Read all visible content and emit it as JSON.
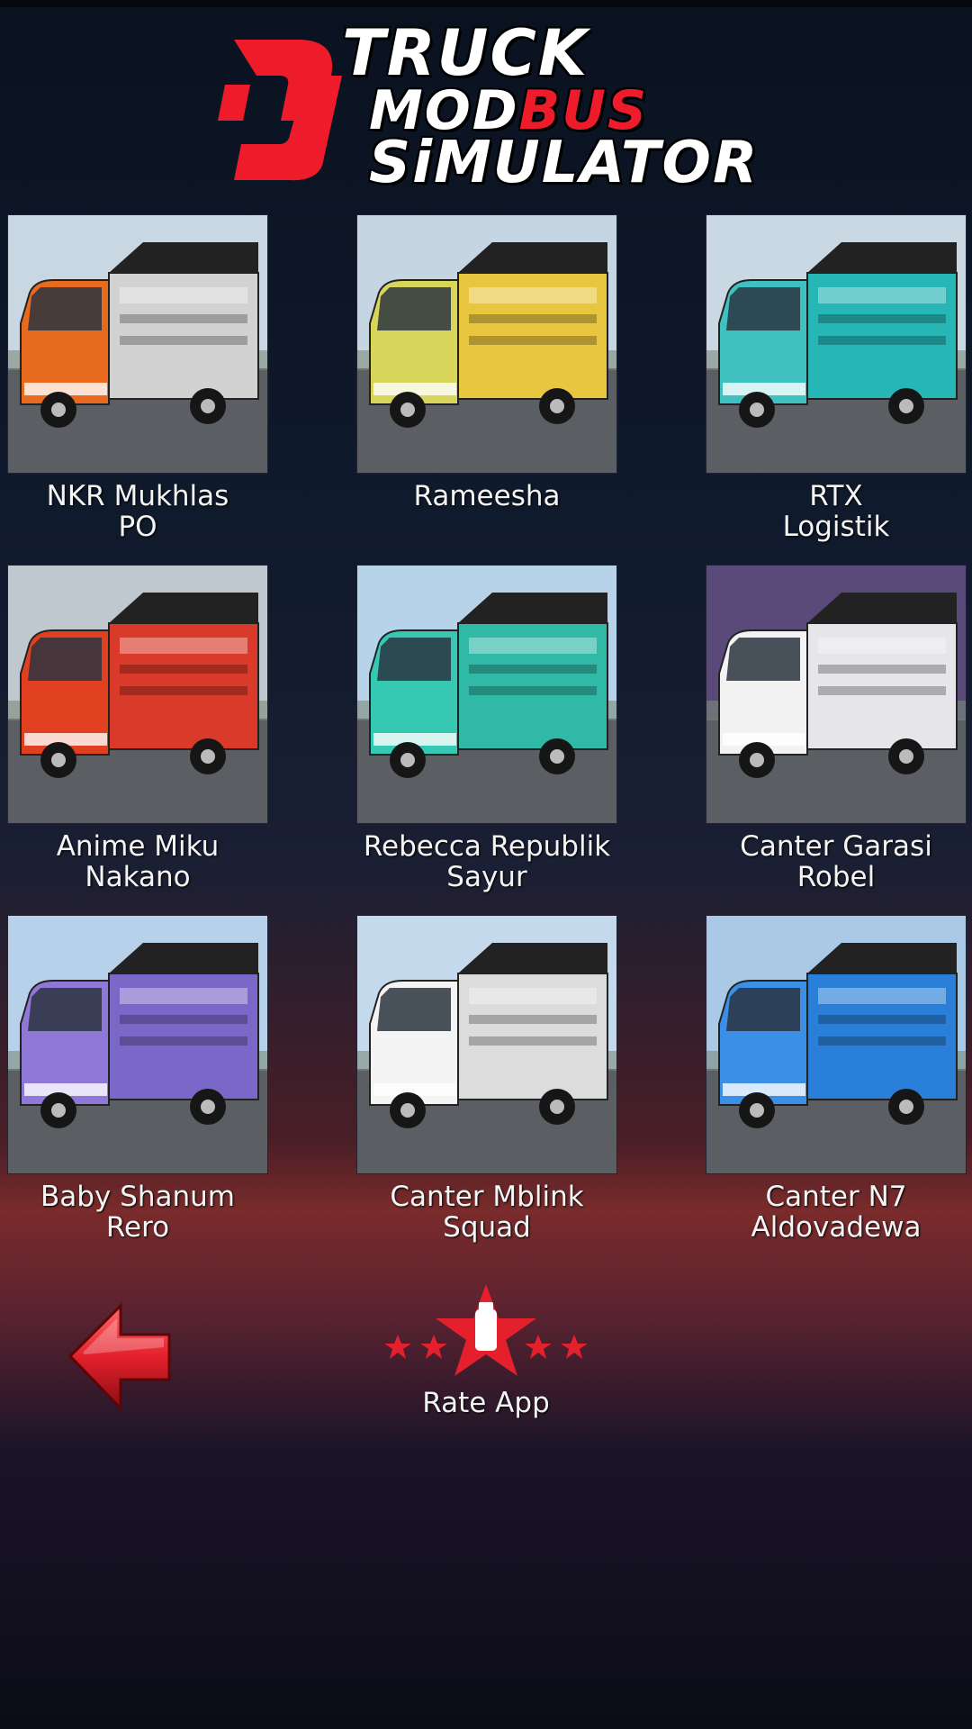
{
  "app": {
    "logo": {
      "mark": "DJ",
      "line1": "TRUCK",
      "line2_a": "MOD",
      "line2_b": "BUS",
      "line3": "SiMULATOR"
    }
  },
  "grid": {
    "items": [
      {
        "line1": "NKR Mukhlas",
        "line2": "PO",
        "cab": "#e76a1e",
        "box": "#d2d2d2",
        "sky": "#c9d7e3"
      },
      {
        "line1": "Rameesha",
        "line2": "",
        "cab": "#d8d65a",
        "box": "#e8c640",
        "sky": "#c6d5e2"
      },
      {
        "line1": "RTX",
        "line2": "Logistik",
        "cab": "#3fc1c0",
        "box": "#27b6b6",
        "sky": "#cad8e4"
      },
      {
        "line1": "Anime Miku",
        "line2": "Nakano",
        "cab": "#e0401f",
        "box": "#d93a2a",
        "sky": "#bfc7cf"
      },
      {
        "line1": "Rebecca Republik",
        "line2": "Sayur",
        "cab": "#37c8b4",
        "box": "#2fb9a6",
        "sky": "#b7d3ea"
      },
      {
        "line1": "Canter Garasi",
        "line2": "Robel",
        "cab": "#f2f2f2",
        "box": "#e5e5ea",
        "sky": "#5a4a7a"
      },
      {
        "line1": "Baby Shanum",
        "line2": "Rero",
        "cab": "#8f78d8",
        "box": "#7a68c8",
        "sky": "#b8d1ea"
      },
      {
        "line1": "Canter Mblink",
        "line2": "Squad",
        "cab": "#f4f4f4",
        "box": "#dcdcdc",
        "sky": "#c4d9ec"
      },
      {
        "line1": "Canter N7",
        "line2": "Aldovadewa",
        "cab": "#3b8fe6",
        "box": "#2a7fd8",
        "sky": "#a9c9e6"
      }
    ]
  },
  "bottom": {
    "rate_label": "Rate App"
  },
  "colors": {
    "accent_red": "#e3202b"
  }
}
